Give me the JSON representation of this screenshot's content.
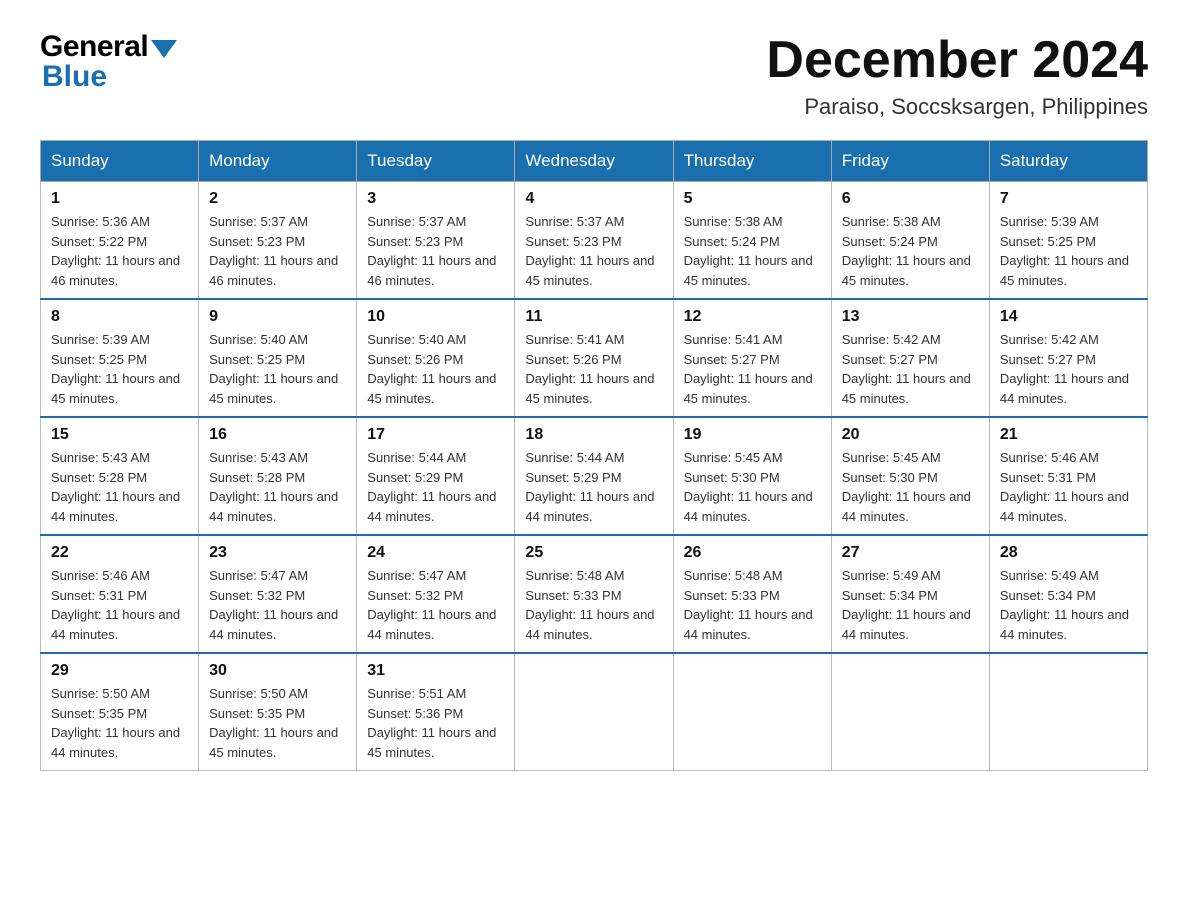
{
  "header": {
    "title": "December 2024",
    "subtitle": "Paraiso, Soccsksargen, Philippines"
  },
  "logo": {
    "general": "General",
    "blue": "Blue"
  },
  "days_of_week": [
    "Sunday",
    "Monday",
    "Tuesday",
    "Wednesday",
    "Thursday",
    "Friday",
    "Saturday"
  ],
  "weeks": [
    [
      {
        "day": "1",
        "sunrise": "5:36 AM",
        "sunset": "5:22 PM",
        "daylight": "11 hours and 46 minutes."
      },
      {
        "day": "2",
        "sunrise": "5:37 AM",
        "sunset": "5:23 PM",
        "daylight": "11 hours and 46 minutes."
      },
      {
        "day": "3",
        "sunrise": "5:37 AM",
        "sunset": "5:23 PM",
        "daylight": "11 hours and 46 minutes."
      },
      {
        "day": "4",
        "sunrise": "5:37 AM",
        "sunset": "5:23 PM",
        "daylight": "11 hours and 45 minutes."
      },
      {
        "day": "5",
        "sunrise": "5:38 AM",
        "sunset": "5:24 PM",
        "daylight": "11 hours and 45 minutes."
      },
      {
        "day": "6",
        "sunrise": "5:38 AM",
        "sunset": "5:24 PM",
        "daylight": "11 hours and 45 minutes."
      },
      {
        "day": "7",
        "sunrise": "5:39 AM",
        "sunset": "5:25 PM",
        "daylight": "11 hours and 45 minutes."
      }
    ],
    [
      {
        "day": "8",
        "sunrise": "5:39 AM",
        "sunset": "5:25 PM",
        "daylight": "11 hours and 45 minutes."
      },
      {
        "day": "9",
        "sunrise": "5:40 AM",
        "sunset": "5:25 PM",
        "daylight": "11 hours and 45 minutes."
      },
      {
        "day": "10",
        "sunrise": "5:40 AM",
        "sunset": "5:26 PM",
        "daylight": "11 hours and 45 minutes."
      },
      {
        "day": "11",
        "sunrise": "5:41 AM",
        "sunset": "5:26 PM",
        "daylight": "11 hours and 45 minutes."
      },
      {
        "day": "12",
        "sunrise": "5:41 AM",
        "sunset": "5:27 PM",
        "daylight": "11 hours and 45 minutes."
      },
      {
        "day": "13",
        "sunrise": "5:42 AM",
        "sunset": "5:27 PM",
        "daylight": "11 hours and 45 minutes."
      },
      {
        "day": "14",
        "sunrise": "5:42 AM",
        "sunset": "5:27 PM",
        "daylight": "11 hours and 44 minutes."
      }
    ],
    [
      {
        "day": "15",
        "sunrise": "5:43 AM",
        "sunset": "5:28 PM",
        "daylight": "11 hours and 44 minutes."
      },
      {
        "day": "16",
        "sunrise": "5:43 AM",
        "sunset": "5:28 PM",
        "daylight": "11 hours and 44 minutes."
      },
      {
        "day": "17",
        "sunrise": "5:44 AM",
        "sunset": "5:29 PM",
        "daylight": "11 hours and 44 minutes."
      },
      {
        "day": "18",
        "sunrise": "5:44 AM",
        "sunset": "5:29 PM",
        "daylight": "11 hours and 44 minutes."
      },
      {
        "day": "19",
        "sunrise": "5:45 AM",
        "sunset": "5:30 PM",
        "daylight": "11 hours and 44 minutes."
      },
      {
        "day": "20",
        "sunrise": "5:45 AM",
        "sunset": "5:30 PM",
        "daylight": "11 hours and 44 minutes."
      },
      {
        "day": "21",
        "sunrise": "5:46 AM",
        "sunset": "5:31 PM",
        "daylight": "11 hours and 44 minutes."
      }
    ],
    [
      {
        "day": "22",
        "sunrise": "5:46 AM",
        "sunset": "5:31 PM",
        "daylight": "11 hours and 44 minutes."
      },
      {
        "day": "23",
        "sunrise": "5:47 AM",
        "sunset": "5:32 PM",
        "daylight": "11 hours and 44 minutes."
      },
      {
        "day": "24",
        "sunrise": "5:47 AM",
        "sunset": "5:32 PM",
        "daylight": "11 hours and 44 minutes."
      },
      {
        "day": "25",
        "sunrise": "5:48 AM",
        "sunset": "5:33 PM",
        "daylight": "11 hours and 44 minutes."
      },
      {
        "day": "26",
        "sunrise": "5:48 AM",
        "sunset": "5:33 PM",
        "daylight": "11 hours and 44 minutes."
      },
      {
        "day": "27",
        "sunrise": "5:49 AM",
        "sunset": "5:34 PM",
        "daylight": "11 hours and 44 minutes."
      },
      {
        "day": "28",
        "sunrise": "5:49 AM",
        "sunset": "5:34 PM",
        "daylight": "11 hours and 44 minutes."
      }
    ],
    [
      {
        "day": "29",
        "sunrise": "5:50 AM",
        "sunset": "5:35 PM",
        "daylight": "11 hours and 44 minutes."
      },
      {
        "day": "30",
        "sunrise": "5:50 AM",
        "sunset": "5:35 PM",
        "daylight": "11 hours and 45 minutes."
      },
      {
        "day": "31",
        "sunrise": "5:51 AM",
        "sunset": "5:36 PM",
        "daylight": "11 hours and 45 minutes."
      },
      null,
      null,
      null,
      null
    ]
  ]
}
